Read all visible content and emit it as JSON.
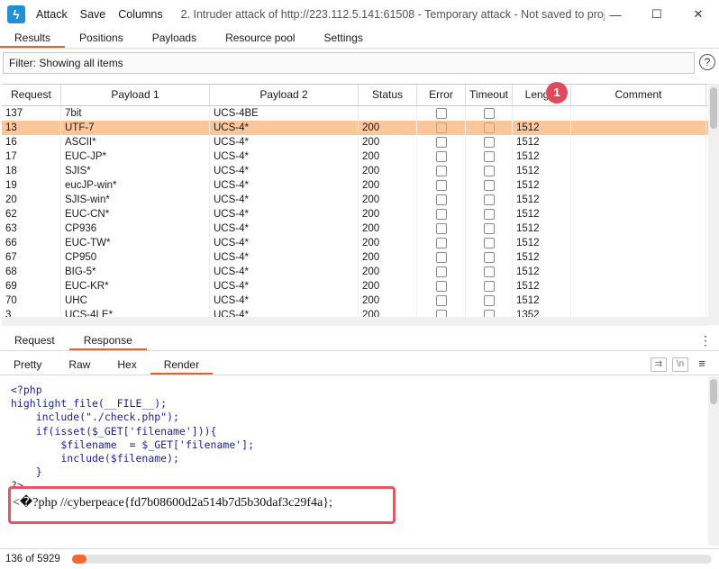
{
  "titlebar": {
    "menu": [
      "Attack",
      "Save",
      "Columns"
    ],
    "title": "2. Intruder attack of http://223.112.5.141:61508 - Temporary attack - Not saved to projec..."
  },
  "tabs": [
    "Results",
    "Positions",
    "Payloads",
    "Resource pool",
    "Settings"
  ],
  "filter": {
    "text": "Filter: Showing all items",
    "help": "?"
  },
  "table": {
    "columns": [
      "Request",
      "Payload 1",
      "Payload 2",
      "Status",
      "Error",
      "Timeout",
      "Length",
      "Comment"
    ],
    "rows": [
      {
        "request": "137",
        "p1": "7bit",
        "p2": "UCS-4BE",
        "status": "",
        "length": ""
      },
      {
        "request": "13",
        "p1": "UTF-7",
        "p2": "UCS-4*",
        "status": "200",
        "length": "1512"
      },
      {
        "request": "16",
        "p1": "ASCII*",
        "p2": "UCS-4*",
        "status": "200",
        "length": "1512"
      },
      {
        "request": "17",
        "p1": "EUC-JP*",
        "p2": "UCS-4*",
        "status": "200",
        "length": "1512"
      },
      {
        "request": "18",
        "p1": "SJIS*",
        "p2": "UCS-4*",
        "status": "200",
        "length": "1512"
      },
      {
        "request": "19",
        "p1": "eucJP-win*",
        "p2": "UCS-4*",
        "status": "200",
        "length": "1512"
      },
      {
        "request": "20",
        "p1": "SJIS-win*",
        "p2": "UCS-4*",
        "status": "200",
        "length": "1512"
      },
      {
        "request": "62",
        "p1": "EUC-CN*",
        "p2": "UCS-4*",
        "status": "200",
        "length": "1512"
      },
      {
        "request": "63",
        "p1": "CP936",
        "p2": "UCS-4*",
        "status": "200",
        "length": "1512"
      },
      {
        "request": "66",
        "p1": "EUC-TW*",
        "p2": "UCS-4*",
        "status": "200",
        "length": "1512"
      },
      {
        "request": "67",
        "p1": "CP950",
        "p2": "UCS-4*",
        "status": "200",
        "length": "1512"
      },
      {
        "request": "68",
        "p1": "BIG-5*",
        "p2": "UCS-4*",
        "status": "200",
        "length": "1512"
      },
      {
        "request": "69",
        "p1": "EUC-KR*",
        "p2": "UCS-4*",
        "status": "200",
        "length": "1512"
      },
      {
        "request": "70",
        "p1": "UHC",
        "p2": "UCS-4*",
        "status": "200",
        "length": "1512"
      },
      {
        "request": "3",
        "p1": "UCS-4LE*",
        "p2": "UCS-4*",
        "status": "200",
        "length": "1352"
      }
    ],
    "selected_row": 1,
    "badge": "1"
  },
  "rr_tabs": [
    "Request",
    "Response"
  ],
  "view_tabs": [
    "Pretty",
    "Raw",
    "Hex",
    "Render"
  ],
  "view_icons": [
    "wrap-icon",
    "newline-icon",
    "menu-icon"
  ],
  "code_lines": [
    "<?php",
    "highlight_file(__FILE__);",
    "    include(\"./check.php\");",
    "    if(isset($_GET['filename'])){",
    "        $filename  = $_GET['filename'];",
    "        include($filename);",
    "    }",
    "?>"
  ],
  "flag_text": "<�?php //cyberpeace{fd7b08600d2a514b7d5b30daf3c29f4a};",
  "status": {
    "text": "136 of 5929",
    "progress": 0.023
  },
  "colors": {
    "accent": "#f26a2e",
    "selection": "#fbc699",
    "highlight_box": "#e45560",
    "badge": "#e0485b"
  }
}
